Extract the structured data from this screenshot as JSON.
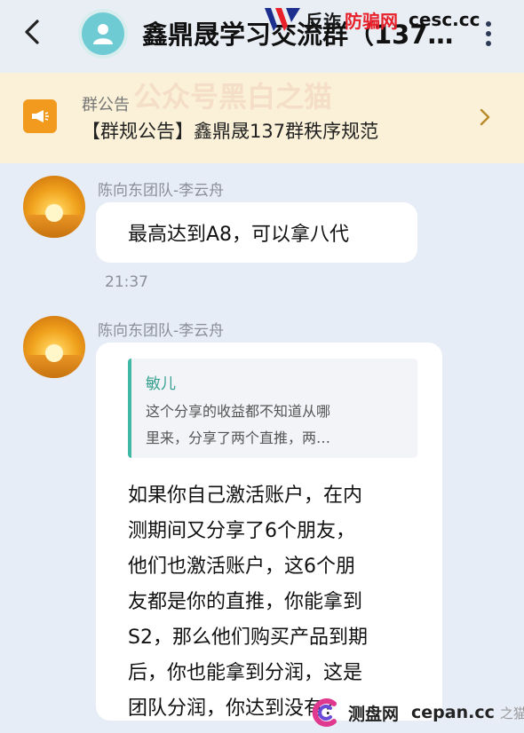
{
  "header": {
    "title": "鑫鼎晟学习交流群（137…",
    "back_icon": "chevron-left-icon",
    "menu_icon": "more-vertical-icon"
  },
  "watermarks": {
    "top_brand": "反诈",
    "top_brand_red": "防骗网",
    "top_domain": "cesc.cc",
    "faint": "公众号黑白之猫",
    "bottom_brand": "测盘网",
    "bottom_domain": "cepan.cc",
    "bottom_small": "之猫"
  },
  "notice": {
    "label": "群公告",
    "text": "【群规公告】鑫鼎晟137群秩序规范"
  },
  "messages": [
    {
      "sender": "陈向东团队-李云舟",
      "text": "最高达到A8，可以拿八代",
      "time": "21:37"
    },
    {
      "sender": "陈向东团队-李云舟",
      "quote": {
        "author": "敏儿",
        "lines": [
          "这个分享的收益都不知道从哪",
          "里来，分享了两个直推，两…"
        ]
      },
      "lines": [
        "如果你自己激活账户，在内",
        "测期间又分享了6个朋友，",
        "他们也激活账户，这6个朋",
        "友都是你的直推，你能拿到",
        "S2，那么他们购买产品到期",
        "后，你也能拿到分润，这是",
        "团队分润，你达到没有？"
      ]
    }
  ],
  "colors": {
    "accent_teal": "#3fb8a6",
    "notice_bg": "#fbf1d8",
    "megaphone": "#f29a1d",
    "chat_bg": "#e7edf6"
  }
}
